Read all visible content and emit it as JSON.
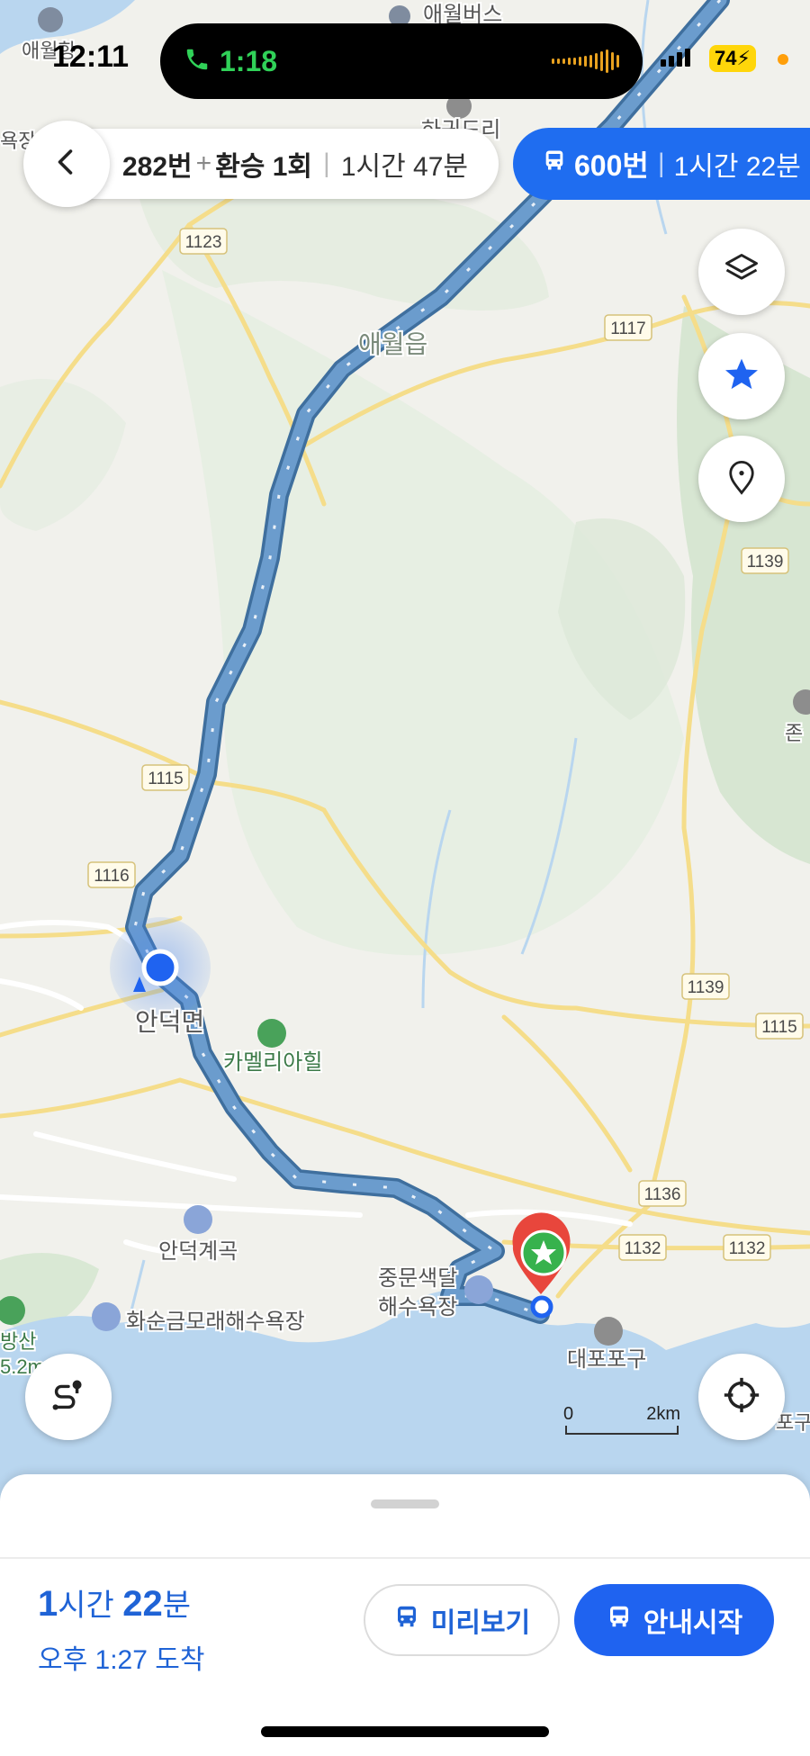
{
  "status_bar": {
    "time": "12:11",
    "call_duration": "1:18",
    "battery": "74"
  },
  "route_header": {
    "primary_route": {
      "bus": "282번",
      "plus": "+",
      "transfer": "환승 1회",
      "separator": "|",
      "duration": "1시간 47분"
    },
    "alternative_route": {
      "bus": "600번",
      "separator": "|",
      "duration": "1시간 22분"
    }
  },
  "map": {
    "labels": {
      "aewol_bus": "애월버스",
      "aewol_port": "애월항",
      "hapjeon": "하귀드리",
      "swim_left": "욕장",
      "aewol_eup": "애월읍",
      "andeok": "안덕면",
      "camellia": "카멜리아힐",
      "andeok_valley": "안덕계곡",
      "hwasun_beach": "화순금모래해수욕장",
      "jungmun_beach_1": "중문색달",
      "jungmun_beach_2": "해수욕장",
      "daepo_port": "대포포구",
      "mountain_1": "방산",
      "mountain_2": "5.2m",
      "jon": "존",
      "right_bottom": "포구"
    },
    "road_badges": [
      "1123",
      "1117",
      "1139",
      "1115",
      "1116",
      "1139",
      "1115",
      "1136",
      "1132",
      "1132"
    ],
    "scale": {
      "start": "0",
      "end": "2km"
    }
  },
  "icons": {
    "back": "chevron-left-icon",
    "layers": "layers-icon",
    "favorite": "star-icon",
    "place": "map-pin-icon",
    "route_overview": "route-icon",
    "my_location": "crosshair-icon",
    "bus": "bus-icon"
  },
  "colors": {
    "accent": "#1f63f0",
    "route": "#6b9ccd",
    "destination_pin": "#e8463c",
    "sea": "#b9d6ef"
  },
  "bottom_sheet": {
    "duration_hours": "1",
    "duration_hours_unit": "시간",
    "duration_minutes": "22",
    "duration_minutes_unit": "분",
    "arrival": "오후 1:27 도착",
    "preview_label": "미리보기",
    "start_label": "안내시작"
  }
}
